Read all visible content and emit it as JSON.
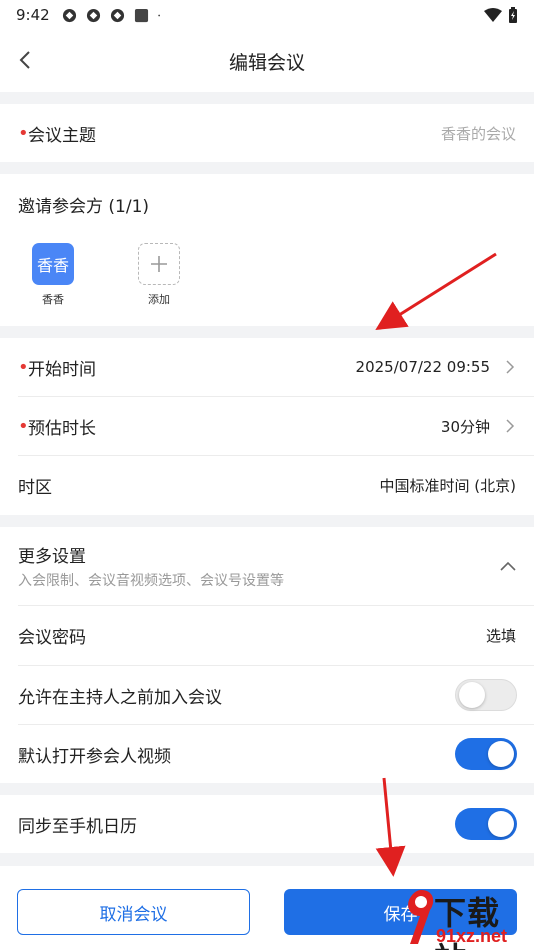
{
  "status_bar": {
    "time": "9:42"
  },
  "header": {
    "title": "编辑会议"
  },
  "meeting_topic": {
    "label": "会议主题",
    "placeholder": "香香的会议"
  },
  "invitees": {
    "label": "邀请参会方 (1/1)",
    "participants": [
      {
        "avatar_text": "香香",
        "name": "香香"
      }
    ],
    "add_label": "添加"
  },
  "schedule": {
    "start_time": {
      "label": "开始时间",
      "value": "2025/07/22 09:55"
    },
    "duration": {
      "label": "预估时长",
      "value": "30分钟"
    },
    "timezone": {
      "label": "时区",
      "value": "中国标准时间 (北京)"
    }
  },
  "more_settings": {
    "title": "更多设置",
    "subtitle": "入会限制、会议音视频选项、会议号设置等",
    "password": {
      "label": "会议密码",
      "value": "选填"
    },
    "join_before_host": {
      "label": "允许在主持人之前加入会议",
      "enabled": false
    },
    "video_on": {
      "label": "默认打开参会人视频",
      "enabled": true
    }
  },
  "sync_calendar": {
    "label": "同步至手机日历",
    "enabled": true
  },
  "actions": {
    "cancel_label": "取消会议",
    "save_label": "保存"
  },
  "colors": {
    "accent": "#1f6fe5",
    "required": "#e53935",
    "avatar": "#4a86f6",
    "annotation_arrow": "#e02020"
  },
  "watermark": {
    "text": "下载站",
    "url": "91xz.net"
  }
}
